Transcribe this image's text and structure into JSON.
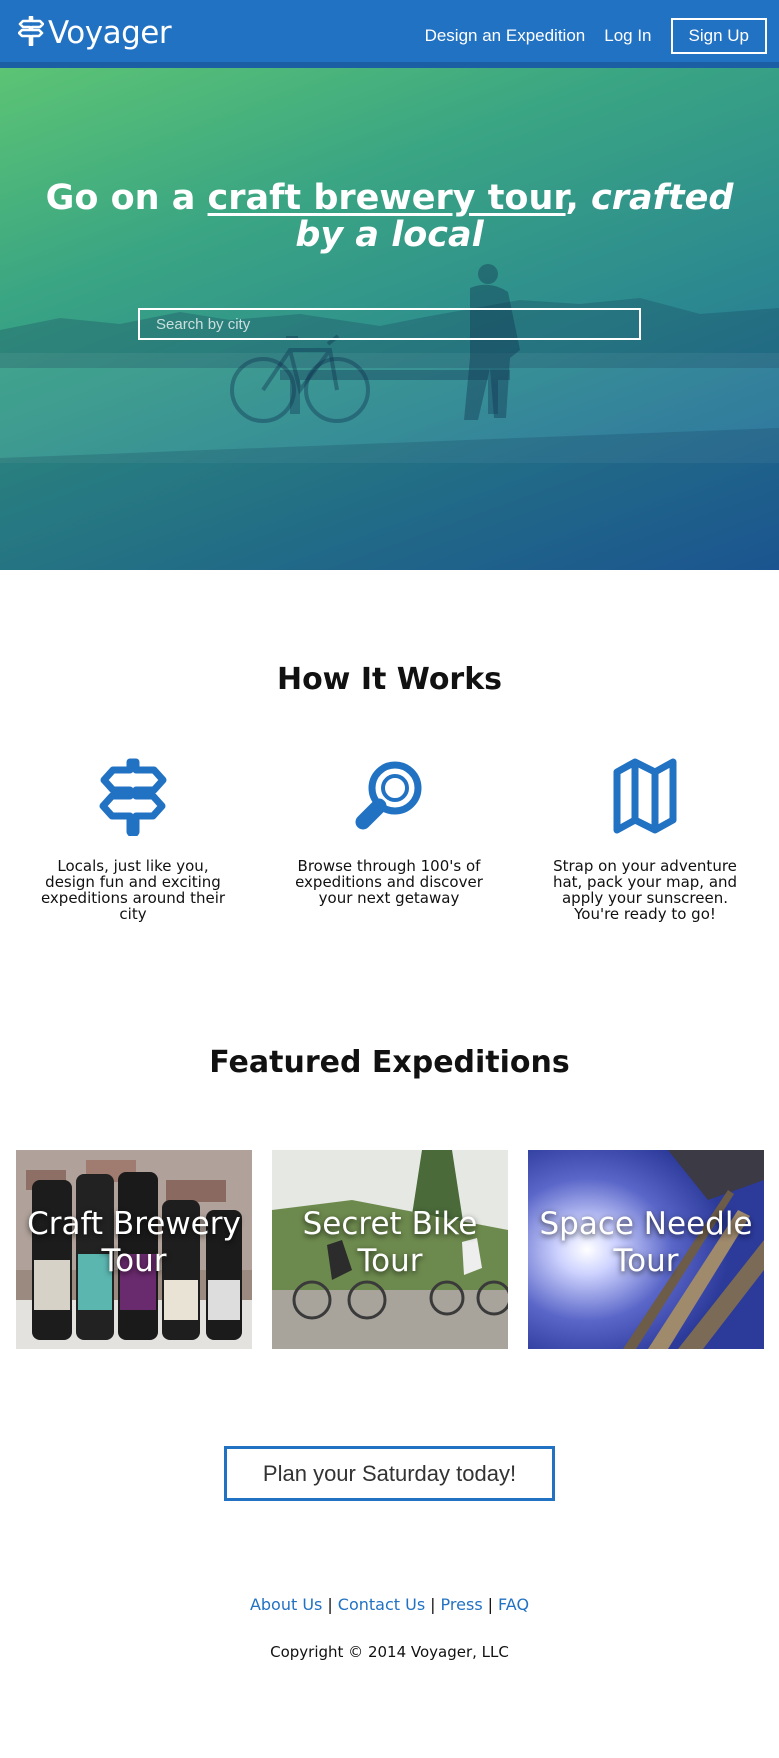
{
  "nav": {
    "brand": "Voyager",
    "links": [
      "Design an Expedition",
      "Log In"
    ],
    "signup": "Sign Up"
  },
  "hero": {
    "prefix": "Go on a ",
    "link_text": "craft brewery tour",
    "comma": ",",
    "suffix": " crafted by a local",
    "search_placeholder": "Search by city"
  },
  "how_it_works": {
    "title": "How It Works",
    "steps": [
      {
        "icon": "signpost-icon",
        "text": "Locals, just like you, design fun and exciting expeditions around their city"
      },
      {
        "icon": "magnifier-icon",
        "text": "Browse through 100's of expeditions and discover your next getaway"
      },
      {
        "icon": "map-icon",
        "text": "Strap on your adventure hat, pack your map, and apply your sunscreen. You're ready to go!"
      }
    ]
  },
  "featured": {
    "title": "Featured Expeditions",
    "cards": [
      "Craft Brewery Tour",
      "Secret Bike Tour",
      "Space Needle Tour"
    ]
  },
  "cta": "Plan your Saturday today!",
  "footer": {
    "links": [
      "About Us",
      "Contact Us",
      "Press",
      "FAQ"
    ],
    "separator": "|",
    "copyright": "Copyright © 2014 Voyager, LLC"
  },
  "colors": {
    "brand_blue": "#2272c3",
    "hero_green": "#5cc474",
    "hero_blue": "#1f5fa0"
  }
}
